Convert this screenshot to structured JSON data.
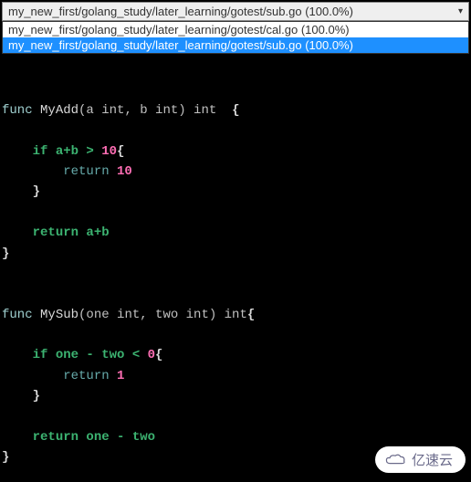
{
  "dropdown": {
    "selected": "my_new_first/golang_study/later_learning/gotest/sub.go (100.0%)",
    "options": [
      {
        "label": "my_new_first/golang_study/later_learning/gotest/cal.go (100.0%)",
        "selected": false
      },
      {
        "label": "my_new_first/golang_study/later_learning/gotest/sub.go (100.0%)",
        "selected": true
      }
    ]
  },
  "code": {
    "func1_sig_func": "func ",
    "func1_name": "MyAdd",
    "func1_params": "(a int, b int) int  ",
    "func1_brace_open": "{",
    "func1_if": "if",
    "func1_cond": " a+b > ",
    "func1_ten_a": "10",
    "func1_brace_if": "{",
    "func1_return1": "return ",
    "func1_ten_b": "10",
    "func1_if_close": "}",
    "func1_return2": "return",
    "func1_ret_expr": " a+b",
    "func1_close": "}",
    "func2_sig_func": "func ",
    "func2_name": "MySub",
    "func2_params": "(one int, two int) int",
    "func2_brace_open": "{",
    "func2_if": "if",
    "func2_cond": " one - two < ",
    "func2_zero": "0",
    "func2_brace_if": "{",
    "func2_return1": "return ",
    "func2_one": "1",
    "func2_if_close": "}",
    "func2_return2": "return",
    "func2_ret_expr": " one - two",
    "func2_close": "}"
  },
  "watermark": {
    "text": "亿速云"
  }
}
